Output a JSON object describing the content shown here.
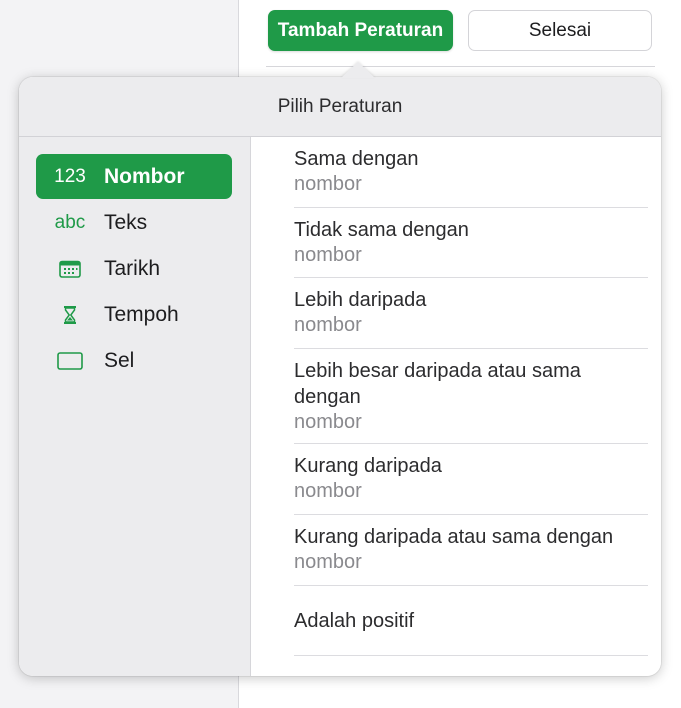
{
  "toolbar": {
    "add_rule_label": "Tambah Peraturan",
    "done_label": "Selesai"
  },
  "popover": {
    "title": "Pilih Peraturan",
    "categories": [
      {
        "icon_text": "123",
        "label": "Nombor",
        "selected": true
      },
      {
        "icon_text": "abc",
        "label": "Teks",
        "selected": false
      },
      {
        "icon": "calendar-icon",
        "label": "Tarikh",
        "selected": false
      },
      {
        "icon": "hourglass-icon",
        "label": "Tempoh",
        "selected": false
      },
      {
        "icon": "cell-icon",
        "label": "Sel",
        "selected": false
      }
    ],
    "rules": [
      {
        "title": "Sama dengan",
        "subtitle": "nombor"
      },
      {
        "title": "Tidak sama dengan",
        "subtitle": "nombor"
      },
      {
        "title": "Lebih daripada",
        "subtitle": "nombor"
      },
      {
        "title": "Lebih besar daripada atau sama dengan",
        "subtitle": "nombor"
      },
      {
        "title": "Kurang daripada",
        "subtitle": "nombor"
      },
      {
        "title": "Kurang daripada atau sama dengan",
        "subtitle": "nombor"
      },
      {
        "title": "Adalah positif"
      }
    ]
  },
  "colors": {
    "accent": "#1f9a48",
    "secondary_text": "#8a8a8e"
  }
}
